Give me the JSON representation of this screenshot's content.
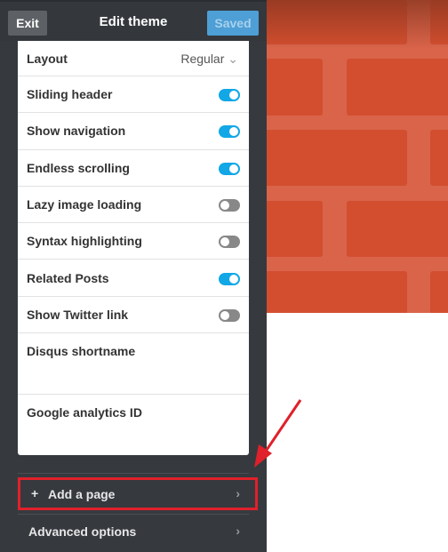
{
  "header": {
    "exit_label": "Exit",
    "title": "Edit theme",
    "saved_label": "Saved"
  },
  "settings": {
    "layout": {
      "label": "Layout",
      "value": "Regular"
    },
    "toggles": [
      {
        "label": "Sliding header",
        "on": true
      },
      {
        "label": "Show navigation",
        "on": true
      },
      {
        "label": "Endless scrolling",
        "on": true
      },
      {
        "label": "Lazy image loading",
        "on": false
      },
      {
        "label": "Syntax highlighting",
        "on": false
      },
      {
        "label": "Related Posts",
        "on": true
      },
      {
        "label": "Show Twitter link",
        "on": false
      }
    ],
    "fields": [
      {
        "label": "Disqus shortname",
        "value": ""
      },
      {
        "label": "Google analytics ID",
        "value": ""
      }
    ]
  },
  "nav": {
    "add_page": "Add a page",
    "advanced": "Advanced options"
  },
  "colors": {
    "toggle_on": "#12a7e6",
    "highlight": "#e0202a",
    "brick": "#d24e2f"
  }
}
